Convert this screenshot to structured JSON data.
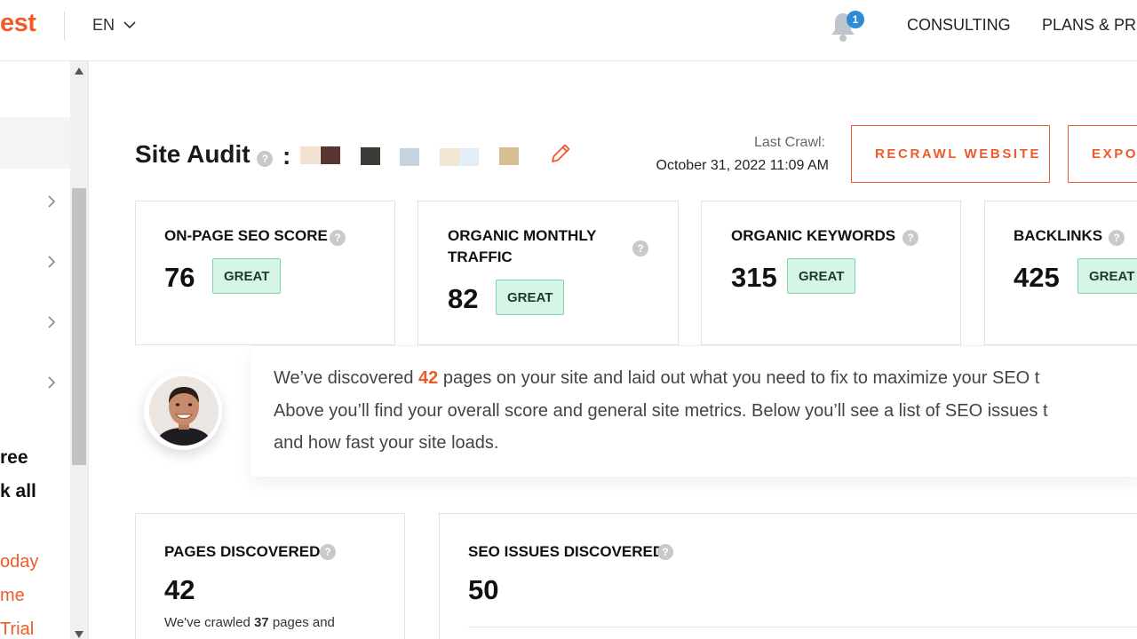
{
  "topbar": {
    "logo_text": "est",
    "language": "EN",
    "notification_count": "1",
    "nav": [
      "CONSULTING",
      "PLANS & PRIC"
    ]
  },
  "sidebar": {
    "text_lines": [
      "ree",
      "k all"
    ],
    "links": [
      "oday",
      "me",
      "Trial"
    ]
  },
  "audit": {
    "title": "Site Audit",
    "colon": ":",
    "last_crawl_label": "Last Crawl:",
    "last_crawl_date": "October 31, 2022 11:09 AM",
    "recrawl_button": "RECRAWL WEBSITE",
    "export_button": "EXPO",
    "redaction_colors": [
      "#f2e2cf",
      "#5a3530",
      "#3e3a36",
      "#c6d4e2",
      "#f1e6d3",
      "#e3eef8",
      "#d6bd94"
    ]
  },
  "metrics": [
    {
      "title": "ON-PAGE SEO SCORE",
      "value": "76",
      "badge": "GREAT"
    },
    {
      "title": "ORGANIC MONTHLY TRAFFIC",
      "value": "82",
      "badge": "GREAT"
    },
    {
      "title": "ORGANIC KEYWORDS",
      "value": "315",
      "badge": "GREAT"
    },
    {
      "title": "BACKLINKS",
      "value": "425",
      "badge": "GREAT"
    }
  ],
  "message": {
    "line1_before": "We’ve discovered ",
    "line1_count": "42",
    "line1_after": " pages on your site and laid out what you need to fix to maximize your SEO t",
    "line2": "Above you’ll find your overall score and general site metrics. Below you’ll see a list of SEO issues t",
    "line3": "and how fast your site loads."
  },
  "bottom_cards": {
    "pages": {
      "title": "PAGES DISCOVERED",
      "value": "42",
      "desc_before": "We've crawled ",
      "desc_count": "37",
      "desc_after": " pages and"
    },
    "issues": {
      "title": "SEO ISSUES DISCOVERED",
      "value": "50"
    }
  },
  "colors": {
    "accent": "#f05a28",
    "great_bg": "#d5f5e6",
    "great_border": "#7fd6ab",
    "badge_blue": "#2f8ad8"
  }
}
